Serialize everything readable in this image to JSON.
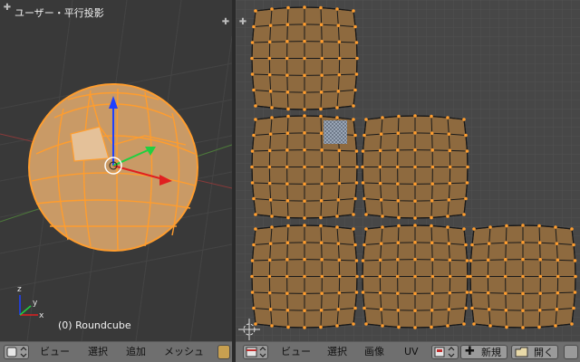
{
  "viewport3d": {
    "title": "ユーザー・平行投影",
    "object_label": "(0) Roundcube",
    "axis_labels": [
      "x",
      "y",
      "z"
    ]
  },
  "header3d": {
    "menus": [
      "ビュー",
      "選択",
      "追加",
      "メッシュ"
    ]
  },
  "headeruv": {
    "menus": [
      "ビュー",
      "選択",
      "画像",
      "UV"
    ],
    "new_label": "新規",
    "open_label": "開く"
  },
  "colors": {
    "viewport_bg": "#393939",
    "uv_bg": "#474747",
    "mesh_fill": "#c99a66",
    "uv_fill": "#8e6a3f",
    "edge_selected": "#ff9d2e",
    "header_bg": "#6f6f6f"
  }
}
